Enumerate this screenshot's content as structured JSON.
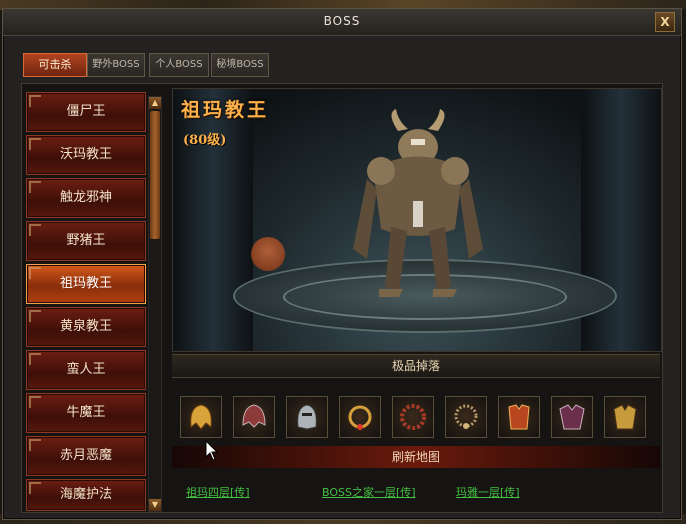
{
  "window": {
    "title": "BOSS",
    "close_label": "X"
  },
  "tabs": [
    {
      "label": "可击杀",
      "active": true
    },
    {
      "label": "野外BOSS",
      "active": false
    },
    {
      "label": "个人BOSS",
      "active": false
    },
    {
      "label": "秘境BOSS",
      "active": false
    }
  ],
  "bosses": [
    {
      "label": "僵尸王",
      "selected": false
    },
    {
      "label": "沃玛教王",
      "selected": false
    },
    {
      "label": "触龙邪神",
      "selected": false
    },
    {
      "label": "野猪王",
      "selected": false
    },
    {
      "label": "祖玛教王",
      "selected": true
    },
    {
      "label": "黄泉教王",
      "selected": false
    },
    {
      "label": "蛮人王",
      "selected": false
    },
    {
      "label": "牛魔王",
      "selected": false
    },
    {
      "label": "赤月恶魔",
      "selected": false
    },
    {
      "label": "海魔护法",
      "selected": false
    }
  ],
  "selected_boss": {
    "name": "祖玛教王",
    "level": "(80级)"
  },
  "drops": {
    "header": "极品掉落",
    "items": [
      "helmet-icon",
      "helmet-icon",
      "helmet-icon",
      "necklace-icon",
      "bracelet-icon",
      "necklace-icon",
      "armor-icon",
      "armor-icon",
      "armor-icon"
    ]
  },
  "refresh_label": "刷新地图",
  "map_links": [
    "祖玛四层[传]",
    "BOSS之家一层[传]",
    "玛雅一层[传]"
  ],
  "colors": {
    "accent": "#ffb24a",
    "link": "#44c043",
    "tab_active": "#b2431f"
  }
}
